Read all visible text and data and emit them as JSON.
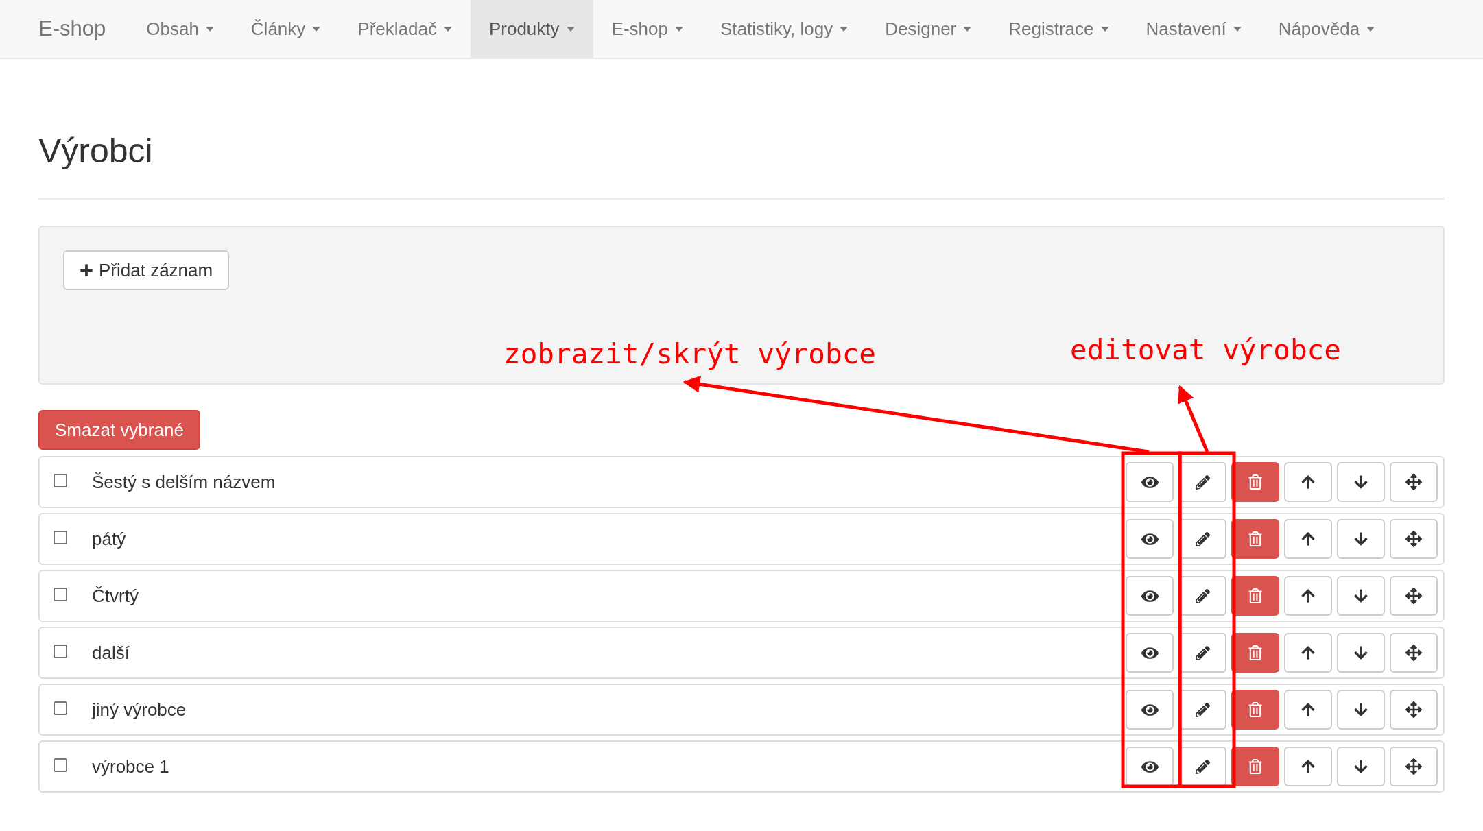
{
  "navbar": {
    "brand": "E-shop",
    "items": [
      {
        "label": "Obsah",
        "selected": false
      },
      {
        "label": "Články",
        "selected": false
      },
      {
        "label": "Překladač",
        "selected": false
      },
      {
        "label": "Produkty",
        "selected": true
      },
      {
        "label": "E-shop",
        "selected": false
      },
      {
        "label": "Statistiky, logy",
        "selected": false
      },
      {
        "label": "Designer",
        "selected": false
      },
      {
        "label": "Registrace",
        "selected": false
      },
      {
        "label": "Nastavení",
        "selected": false
      },
      {
        "label": "Nápověda",
        "selected": false
      }
    ]
  },
  "page_title": "Výrobci",
  "add_button": "Přidat záznam",
  "delete_selected_button": "Smazat vybrané",
  "rows": [
    {
      "name": "Šestý s delším názvem",
      "checked": false
    },
    {
      "name": "pátý",
      "checked": false
    },
    {
      "name": "Čtvrtý",
      "checked": false
    },
    {
      "name": "další",
      "checked": false
    },
    {
      "name": "jiný výrobce",
      "checked": false
    },
    {
      "name": "výrobce 1",
      "checked": false
    }
  ],
  "annotations": [
    "zobrazit/skrýt výrobce",
    "editovat výrobce"
  ]
}
